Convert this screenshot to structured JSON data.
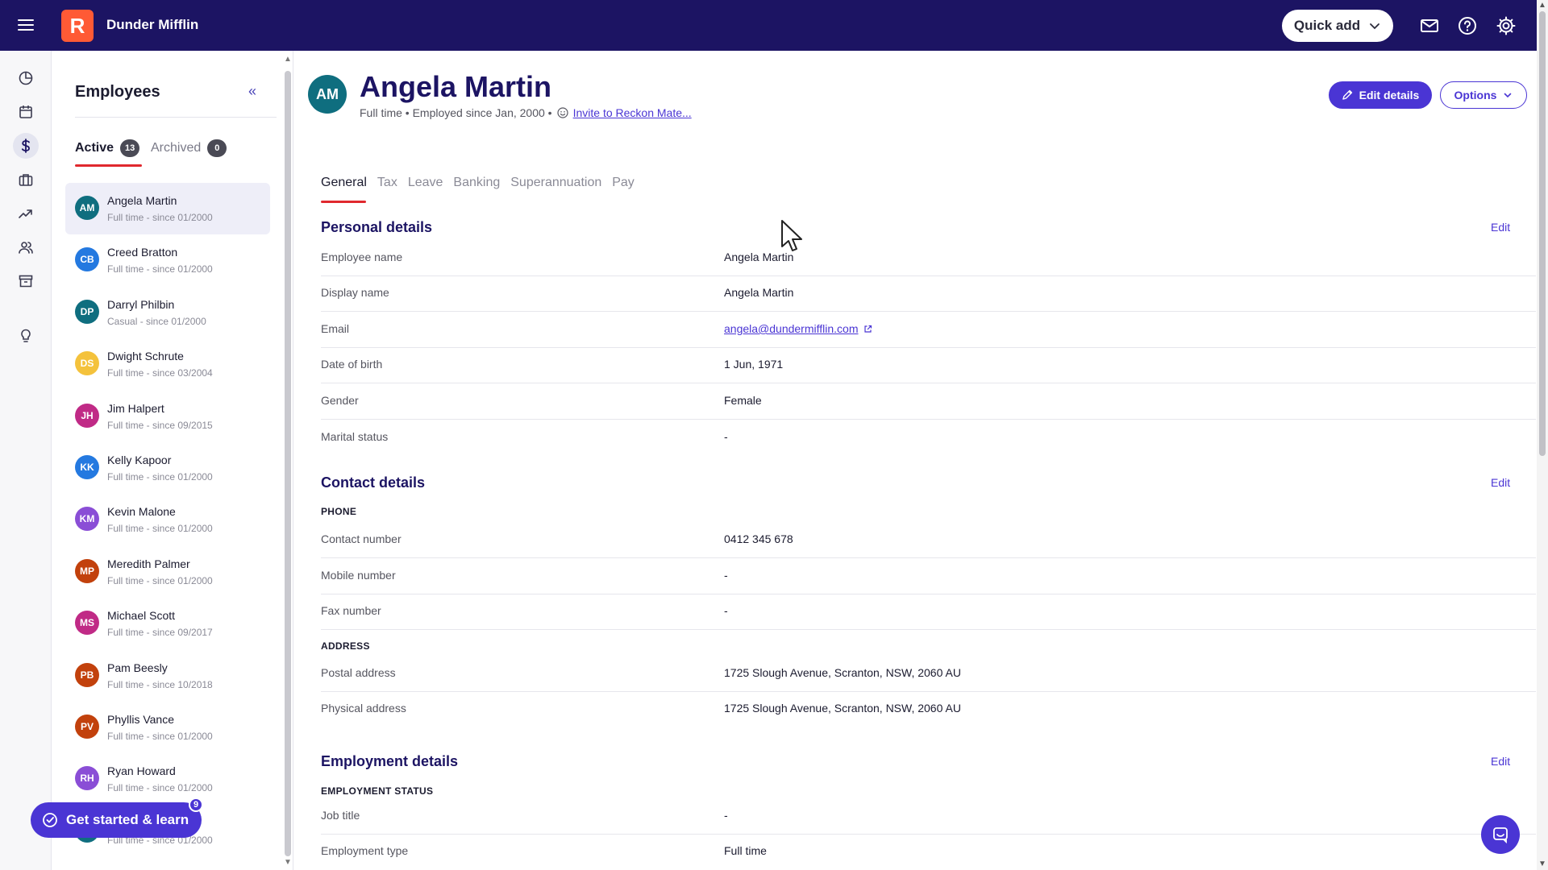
{
  "app": {
    "company": "Dunder Mifflin",
    "logo_letter": "R"
  },
  "topbar": {
    "quick_add_label": "Quick add",
    "icons": [
      "menu-icon",
      "mail-icon",
      "help-icon",
      "settings-icon"
    ]
  },
  "rail": {
    "items": [
      "dashboard-icon",
      "calendar-icon",
      "dollar-icon",
      "briefcase-icon",
      "trend-icon",
      "people-icon",
      "archive-icon",
      "lightbulb-icon"
    ],
    "active": "dollar-icon"
  },
  "employees_panel": {
    "title": "Employees",
    "tabs": [
      {
        "label": "Active",
        "count": "13"
      },
      {
        "label": "Archived",
        "count": "0"
      }
    ],
    "items": [
      {
        "initials": "AM",
        "name": "Angela Martin",
        "sub": "Full time - since 01/2000",
        "color": "#0f6e7f"
      },
      {
        "initials": "CB",
        "name": "Creed Bratton",
        "sub": "Full time - since 01/2000",
        "color": "#2479e0"
      },
      {
        "initials": "DP",
        "name": "Darryl Philbin",
        "sub": "Casual - since 01/2000",
        "color": "#0f6e7f"
      },
      {
        "initials": "DS",
        "name": "Dwight Schrute",
        "sub": "Full time - since 03/2004",
        "color": "#f4c23c"
      },
      {
        "initials": "JH",
        "name": "Jim Halpert",
        "sub": "Full time - since 09/2015",
        "color": "#c02a86"
      },
      {
        "initials": "KK",
        "name": "Kelly Kapoor",
        "sub": "Full time - since 01/2000",
        "color": "#2479e0"
      },
      {
        "initials": "KM",
        "name": "Kevin Malone",
        "sub": "Full time - since 01/2000",
        "color": "#8a4ed6"
      },
      {
        "initials": "MP",
        "name": "Meredith Palmer",
        "sub": "Full time - since 01/2000",
        "color": "#c2410c"
      },
      {
        "initials": "MS",
        "name": "Michael Scott",
        "sub": "Full time - since 09/2017",
        "color": "#c02a86"
      },
      {
        "initials": "PB",
        "name": "Pam Beesly",
        "sub": "Full time - since 10/2018",
        "color": "#c2410c"
      },
      {
        "initials": "PV",
        "name": "Phyllis Vance",
        "sub": "Full time - since 01/2000",
        "color": "#c2410c"
      },
      {
        "initials": "RH",
        "name": "Ryan Howard",
        "sub": "Full time - since 01/2000",
        "color": "#8a4ed6"
      },
      {
        "initials": "",
        "name": "",
        "sub": "Full time - since 01/2000",
        "color": "#0f6e7f"
      }
    ]
  },
  "get_started": {
    "label": "Get started & learn",
    "badge": "9"
  },
  "employee": {
    "initials": "AM",
    "name": "Angela Martin",
    "summary": "Full time • Employed since Jan, 2000 •",
    "invite_link": "Invite to Reckon Mate...",
    "edit_details_label": "Edit details",
    "options_label": "Options"
  },
  "tabs": [
    "General",
    "Tax",
    "Leave",
    "Banking",
    "Superannuation",
    "Pay"
  ],
  "sections": {
    "personal": {
      "title": "Personal details",
      "edit": "Edit",
      "rows": [
        {
          "label": "Employee name",
          "value": "Angela Martin"
        },
        {
          "label": "Display name",
          "value": "Angela Martin"
        },
        {
          "label": "Email",
          "value": "angela@dundermifflin.com"
        },
        {
          "label": "Date of birth",
          "value": "1 Jun, 1971"
        },
        {
          "label": "Gender",
          "value": "Female"
        },
        {
          "label": "Marital status",
          "value": "-"
        }
      ]
    },
    "contact": {
      "title": "Contact details",
      "edit": "Edit",
      "phone_heading": "PHONE",
      "phone_rows": [
        {
          "label": "Contact number",
          "value": "0412 345 678"
        },
        {
          "label": "Mobile number",
          "value": "-"
        },
        {
          "label": "Fax number",
          "value": "-"
        }
      ],
      "address_heading": "ADDRESS",
      "address_rows": [
        {
          "label": "Postal address",
          "value": "1725 Slough Avenue, Scranton, NSW, 2060 AU"
        },
        {
          "label": "Physical address",
          "value": "1725 Slough Avenue, Scranton, NSW, 2060 AU"
        }
      ]
    },
    "employment": {
      "title": "Employment details",
      "edit": "Edit",
      "status_heading": "EMPLOYMENT STATUS",
      "rows": [
        {
          "label": "Job title",
          "value": "-"
        },
        {
          "label": "Employment type",
          "value": "Full time"
        }
      ]
    }
  },
  "colors": {
    "topbar": "#1c1463",
    "accent": "#4a35d4",
    "tab_underline": "#e0282e",
    "logo": "#ff5a35"
  }
}
